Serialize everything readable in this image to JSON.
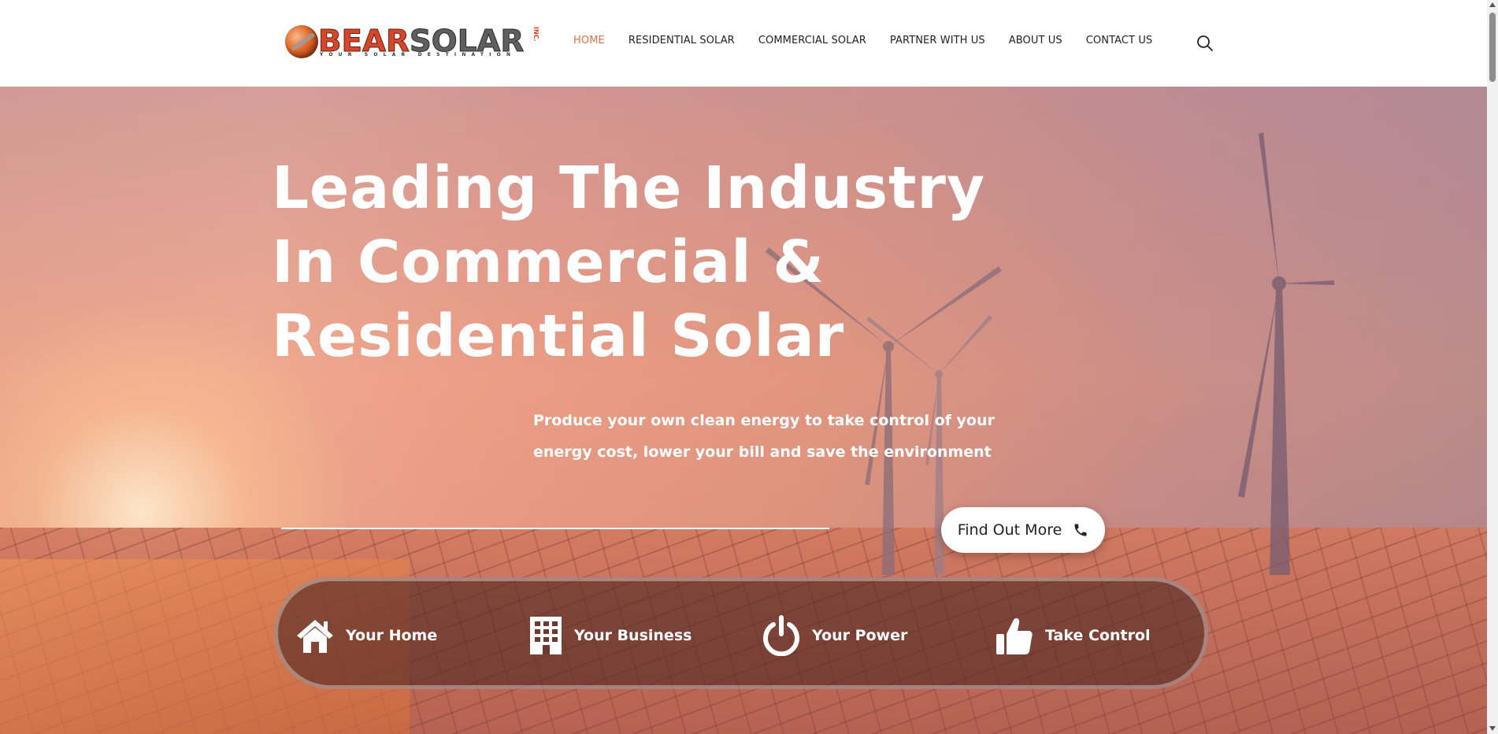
{
  "logo": {
    "brand_part1": "BEAR",
    "brand_part2": "SOLAR",
    "suffix": "INC.",
    "tagline": "YOUR SOLAR DESTINATION"
  },
  "nav": {
    "items": [
      {
        "label": "HOME",
        "active": true
      },
      {
        "label": "RESIDENTIAL SOLAR",
        "active": false
      },
      {
        "label": "COMMERCIAL SOLAR",
        "active": false
      },
      {
        "label": "PARTNER WITH US",
        "active": false
      },
      {
        "label": "ABOUT US",
        "active": false
      },
      {
        "label": "CONTACT US",
        "active": false
      }
    ],
    "search_icon": "search-icon"
  },
  "hero": {
    "headline_lines": [
      "Leading The Industry",
      "In Commercial &",
      "Residential Solar"
    ],
    "subtext_lines": [
      "Produce your own clean energy to take control of your",
      "energy cost, lower your bill and save the environment"
    ],
    "cta": {
      "label": "Find Out More",
      "icon": "phone-icon"
    }
  },
  "features": [
    {
      "label": "Your Home",
      "icon": "home-icon"
    },
    {
      "label": "Your Business",
      "icon": "building-icon"
    },
    {
      "label": "Your Power",
      "icon": "power-icon"
    },
    {
      "label": "Take Control",
      "icon": "thumbs-up-icon"
    }
  ],
  "colors": {
    "nav_active": "#d9734a",
    "brand_red": "#d5462a",
    "brand_gray": "#5f5f5f"
  }
}
